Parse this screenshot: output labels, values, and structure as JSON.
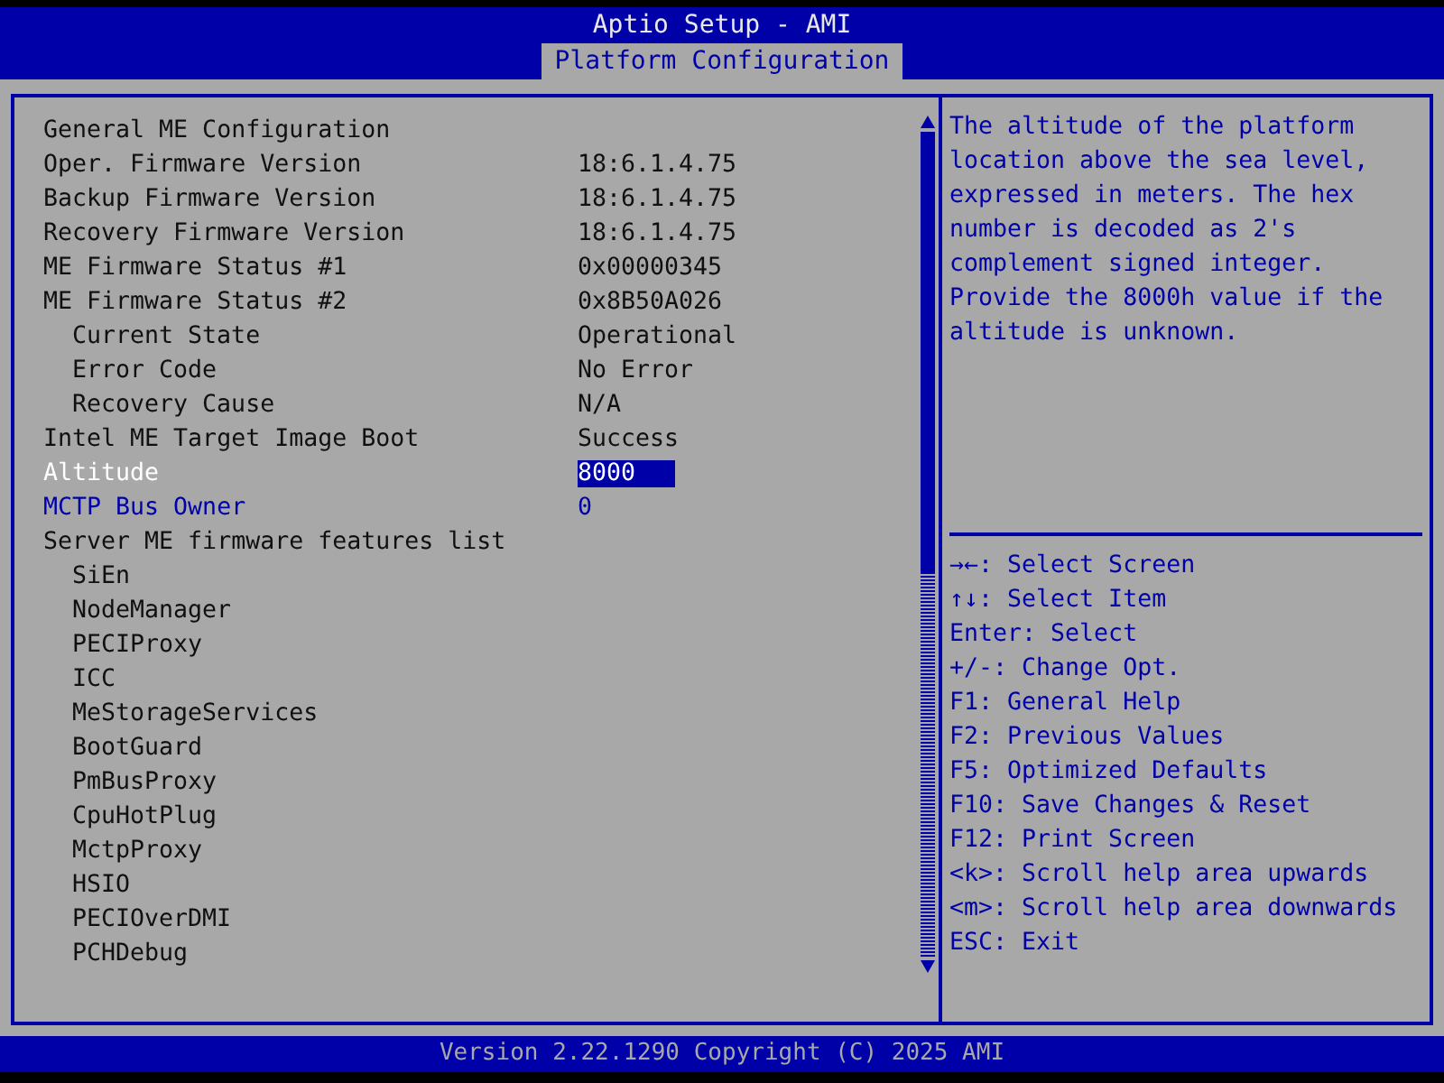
{
  "window": {
    "title": "Aptio Setup - AMI"
  },
  "tabs": [
    {
      "label": "Platform Configuration",
      "selected": true
    }
  ],
  "settings": [
    {
      "kind": "info",
      "label": "General ME Configuration"
    },
    {
      "kind": "info",
      "label": "Oper. Firmware Version",
      "value": "18:6.1.4.75"
    },
    {
      "kind": "info",
      "label": "Backup Firmware Version",
      "value": "18:6.1.4.75"
    },
    {
      "kind": "info",
      "label": "Recovery Firmware Version",
      "value": "18:6.1.4.75"
    },
    {
      "kind": "info",
      "label": "ME Firmware Status #1",
      "value": "0x00000345"
    },
    {
      "kind": "info",
      "label": "ME Firmware Status #2",
      "value": "0x8B50A026",
      "children": [
        {
          "kind": "info",
          "label": "Current State",
          "value": "Operational"
        },
        {
          "kind": "info",
          "label": "Error Code",
          "value": "No Error"
        },
        {
          "kind": "info",
          "label": "Recovery Cause",
          "value": "N/A"
        }
      ]
    },
    {
      "kind": "info",
      "label": "Intel ME Target Image Boot",
      "value": "Success"
    },
    {
      "kind": "setting",
      "label": "Altitude",
      "value": "8000",
      "selected": true
    },
    {
      "kind": "setting",
      "label": "MCTP Bus Owner",
      "value": "0",
      "selected": false
    },
    {
      "kind": "info",
      "label": "Server ME firmware features list",
      "children": [
        {
          "kind": "info",
          "label": "SiEn"
        },
        {
          "kind": "info",
          "label": "NodeManager"
        },
        {
          "kind": "info",
          "label": "PECIProxy"
        },
        {
          "kind": "info",
          "label": "ICC"
        },
        {
          "kind": "info",
          "label": "MeStorageServices"
        },
        {
          "kind": "info",
          "label": "BootGuard"
        },
        {
          "kind": "info",
          "label": "PmBusProxy"
        },
        {
          "kind": "info",
          "label": "CpuHotPlug"
        },
        {
          "kind": "info",
          "label": "MctpProxy"
        },
        {
          "kind": "info",
          "label": "HSIO"
        },
        {
          "kind": "info",
          "label": "PECIOverDMI"
        },
        {
          "kind": "info",
          "label": "PCHDebug"
        }
      ]
    }
  ],
  "help_text": "The altitude of the platform location above the sea level, expressed in meters. The hex number is decoded as 2's complement signed integer. Provide the 8000h value if the altitude is unknown.",
  "key_help": [
    "→←: Select Screen",
    "↑↓: Select Item",
    "Enter: Select",
    "+/-: Change Opt.",
    "F1: General Help",
    "F2: Previous Values",
    "F5: Optimized Defaults",
    "F10: Save Changes & Reset",
    "F12: Print Screen",
    "<k>: Scroll help area upwards",
    "<m>: Scroll help area downwards",
    "ESC: Exit"
  ],
  "status_bar": "Version 2.22.1290 Copyright (C) 2025 AMI"
}
